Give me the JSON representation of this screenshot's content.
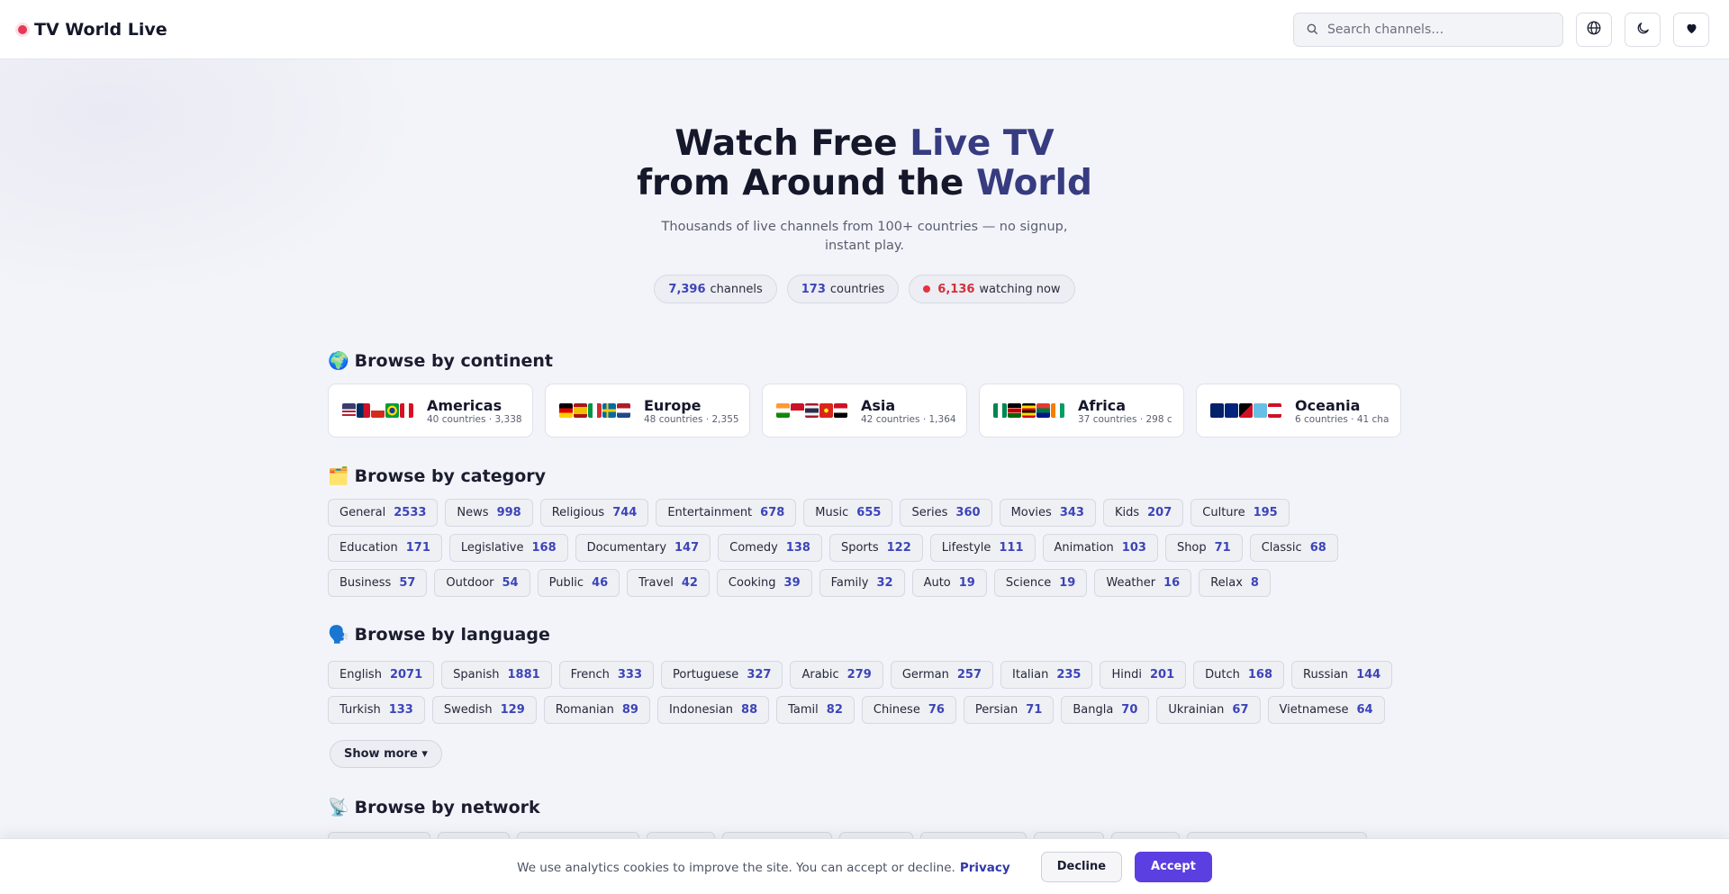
{
  "header": {
    "brand": "TV World Live",
    "search_placeholder": "Search channels…",
    "icons": [
      "globe-icon",
      "moon-icon",
      "heart-icon"
    ]
  },
  "hero": {
    "title_line1_plain": "Watch Free ",
    "title_line1_accent": "Live TV",
    "title_line2_plain": "from Around the ",
    "title_line2_accent": "World",
    "subtitle": "Thousands of live channels from 100+ countries — no signup, instant play.",
    "stats": [
      {
        "value": "7,396",
        "label": "channels",
        "live": false
      },
      {
        "value": "173",
        "label": "countries",
        "live": false
      },
      {
        "value": "6,136",
        "label": "watching now",
        "live": true
      }
    ]
  },
  "continents_section": {
    "emoji": "🌍",
    "title": "Browse by continent",
    "items": [
      {
        "name": "Americas",
        "meta": "40 countries · 3,338",
        "flags": [
          "us",
          "do",
          "cl",
          "br",
          "pe"
        ]
      },
      {
        "name": "Europe",
        "meta": "48 countries · 2,355",
        "flags": [
          "de",
          "es",
          "it",
          "se",
          "nl"
        ]
      },
      {
        "name": "Asia",
        "meta": "42 countries · 1,364",
        "flags": [
          "in",
          "id",
          "th",
          "vn",
          "iq"
        ]
      },
      {
        "name": "Africa",
        "meta": "37 countries · 298 c",
        "flags": [
          "ng",
          "ke",
          "ug",
          "za",
          "ci"
        ]
      },
      {
        "name": "Oceania",
        "meta": "6 countries · 41 cha",
        "flags": [
          "au",
          "nz",
          "pg",
          "fj",
          "pf"
        ]
      }
    ]
  },
  "category_section": {
    "emoji": "🗂️",
    "title": "Browse by category",
    "items": [
      {
        "label": "General",
        "count": "2533"
      },
      {
        "label": "News",
        "count": "998"
      },
      {
        "label": "Religious",
        "count": "744"
      },
      {
        "label": "Entertainment",
        "count": "678"
      },
      {
        "label": "Music",
        "count": "655"
      },
      {
        "label": "Series",
        "count": "360"
      },
      {
        "label": "Movies",
        "count": "343"
      },
      {
        "label": "Kids",
        "count": "207"
      },
      {
        "label": "Culture",
        "count": "195"
      },
      {
        "label": "Education",
        "count": "171"
      },
      {
        "label": "Legislative",
        "count": "168"
      },
      {
        "label": "Documentary",
        "count": "147"
      },
      {
        "label": "Comedy",
        "count": "138"
      },
      {
        "label": "Sports",
        "count": "122"
      },
      {
        "label": "Lifestyle",
        "count": "111"
      },
      {
        "label": "Animation",
        "count": "103"
      },
      {
        "label": "Shop",
        "count": "71"
      },
      {
        "label": "Classic",
        "count": "68"
      },
      {
        "label": "Business",
        "count": "57"
      },
      {
        "label": "Outdoor",
        "count": "54"
      },
      {
        "label": "Public",
        "count": "46"
      },
      {
        "label": "Travel",
        "count": "42"
      },
      {
        "label": "Cooking",
        "count": "39"
      },
      {
        "label": "Family",
        "count": "32"
      },
      {
        "label": "Auto",
        "count": "19"
      },
      {
        "label": "Science",
        "count": "19"
      },
      {
        "label": "Weather",
        "count": "16"
      },
      {
        "label": "Relax",
        "count": "8"
      }
    ]
  },
  "language_section": {
    "emoji": "🗣️",
    "title": "Browse by language",
    "items": [
      {
        "label": "English",
        "count": "2071"
      },
      {
        "label": "Spanish",
        "count": "1881"
      },
      {
        "label": "French",
        "count": "333"
      },
      {
        "label": "Portuguese",
        "count": "327"
      },
      {
        "label": "Arabic",
        "count": "279"
      },
      {
        "label": "German",
        "count": "257"
      },
      {
        "label": "Italian",
        "count": "235"
      },
      {
        "label": "Hindi",
        "count": "201"
      },
      {
        "label": "Dutch",
        "count": "168"
      },
      {
        "label": "Russian",
        "count": "144"
      },
      {
        "label": "Turkish",
        "count": "133"
      },
      {
        "label": "Swedish",
        "count": "129"
      },
      {
        "label": "Romanian",
        "count": "89"
      },
      {
        "label": "Indonesian",
        "count": "88"
      },
      {
        "label": "Tamil",
        "count": "82"
      },
      {
        "label": "Chinese",
        "count": "76"
      },
      {
        "label": "Persian",
        "count": "71"
      },
      {
        "label": "Bangla",
        "count": "70"
      },
      {
        "label": "Ukrainian",
        "count": "67"
      },
      {
        "label": "Vietnamese",
        "count": "64"
      }
    ],
    "show_more": "Show more ▾"
  },
  "network_section": {
    "emoji": "📡",
    "title": "Browse by network"
  },
  "cookie_banner": {
    "text": "We use analytics cookies to improve the site. You can accept or decline.",
    "privacy_label": "Privacy",
    "decline_label": "Decline",
    "accept_label": "Accept"
  },
  "colors": {
    "accent": "#3d44b8",
    "live": "#e53340",
    "brand_dot": "#e53956",
    "accept_button": "#5b3fe0"
  }
}
